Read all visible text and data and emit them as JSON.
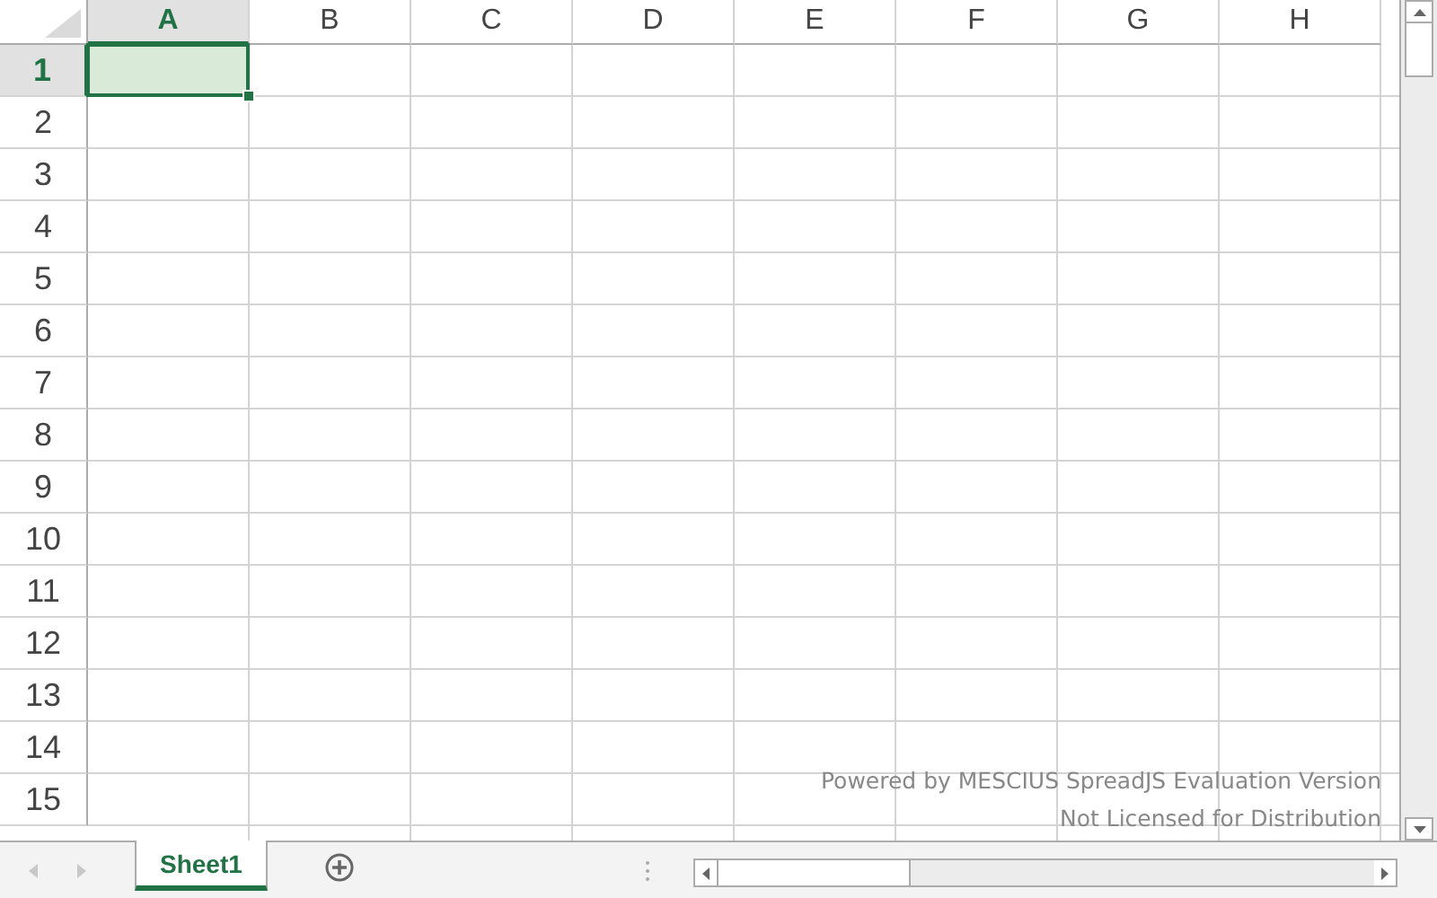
{
  "columns": [
    {
      "label": "A",
      "selected": true
    },
    {
      "label": "B",
      "selected": false
    },
    {
      "label": "C",
      "selected": false
    },
    {
      "label": "D",
      "selected": false
    },
    {
      "label": "E",
      "selected": false
    },
    {
      "label": "F",
      "selected": false
    },
    {
      "label": "G",
      "selected": false
    },
    {
      "label": "H",
      "selected": false
    }
  ],
  "rows": [
    {
      "label": "1",
      "selected": true
    },
    {
      "label": "2",
      "selected": false
    },
    {
      "label": "3",
      "selected": false
    },
    {
      "label": "4",
      "selected": false
    },
    {
      "label": "5",
      "selected": false
    },
    {
      "label": "6",
      "selected": false
    },
    {
      "label": "7",
      "selected": false
    },
    {
      "label": "8",
      "selected": false
    },
    {
      "label": "9",
      "selected": false
    },
    {
      "label": "10",
      "selected": false
    },
    {
      "label": "11",
      "selected": false
    },
    {
      "label": "12",
      "selected": false
    },
    {
      "label": "13",
      "selected": false
    },
    {
      "label": "14",
      "selected": false
    },
    {
      "label": "15",
      "selected": false
    }
  ],
  "evaluation_notice": [
    "Powered by MESCIUS SpreadJS Evaluation Version",
    "Not Licensed for Distribution"
  ],
  "sheet_tabs": [
    {
      "label": "Sheet1",
      "selected": true
    }
  ]
}
